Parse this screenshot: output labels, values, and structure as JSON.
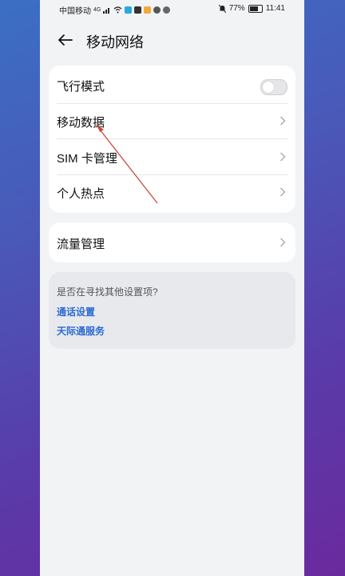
{
  "statusbar": {
    "carrier": "中国移动",
    "signal_label": "4G",
    "battery": "77%",
    "time": "11:41"
  },
  "header": {
    "title": "移动网络"
  },
  "settings": [
    {
      "label": "飞行模式",
      "control": "toggle",
      "on": false
    },
    {
      "label": "移动数据",
      "control": "chevron"
    },
    {
      "label": "SIM 卡管理",
      "control": "chevron"
    },
    {
      "label": "个人热点",
      "control": "chevron"
    }
  ],
  "traffic": {
    "label": "流量管理"
  },
  "suggestions": {
    "question": "是否在寻找其他设置项?",
    "links": [
      "通话设置",
      "天际通服务"
    ]
  },
  "colors": {
    "link": "#2b6ad0",
    "annotation": "#c94a3a"
  }
}
